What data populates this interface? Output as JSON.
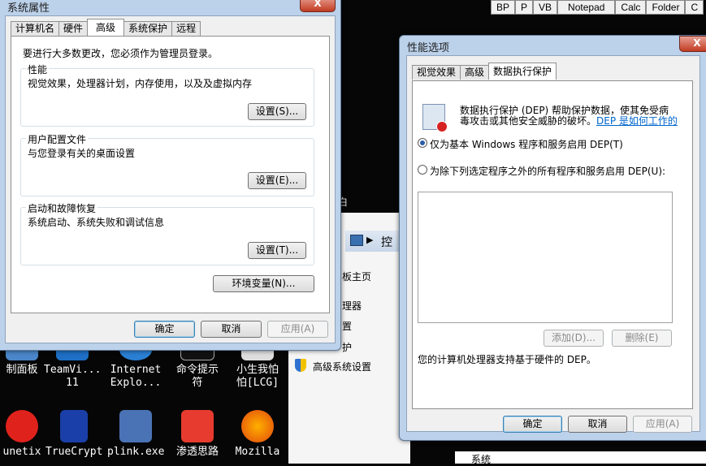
{
  "taskbar": {
    "buttons": [
      "BP",
      "P",
      "VB",
      "Notepad",
      "Calc",
      "Folder",
      "C"
    ]
  },
  "desktop": {
    "icons": [
      {
        "label1": "制面板",
        "label2": ""
      },
      {
        "label1": "TeamVi...",
        "label2": "11"
      },
      {
        "label1": "Internet",
        "label2": "Explo..."
      },
      {
        "label1": "命令提示",
        "label2": "符"
      },
      {
        "label1": "小生我怕",
        "label2": "怕[LCG]"
      },
      {
        "label1": "unetix",
        "label2": ""
      },
      {
        "label1": "TrueCrypt",
        "label2": ""
      },
      {
        "label1": "plink.exe",
        "label2": ""
      },
      {
        "label1": "渗透思路",
        "label2": ""
      },
      {
        "label1": "Mozilla",
        "label2": ""
      }
    ]
  },
  "bg_window": {
    "address": "控",
    "items": [
      "板主页",
      "理器",
      "置",
      "护",
      "高级系统设置"
    ],
    "fragment": "白",
    "bottom_label": "系统"
  },
  "sys_props": {
    "title": "系统属性",
    "close": "X",
    "tabs": [
      "计算机名",
      "硬件",
      "高级",
      "系统保护",
      "远程"
    ],
    "active_tab": "高级",
    "admin_note": "要进行大多数更改，您必须作为管理员登录。",
    "perf_label": "性能",
    "perf_desc": "视觉效果，处理器计划，内存使用，以及及虚拟内存",
    "perf_button": "设置(S)...",
    "profile_label": "用户配置文件",
    "profile_desc": "与您登录有关的桌面设置",
    "profile_button": "设置(E)...",
    "startup_label": "启动和故障恢复",
    "startup_desc": "系统启动、系统失败和调试信息",
    "startup_button": "设置(T)...",
    "env_button": "环境变量(N)...",
    "ok": "确定",
    "cancel": "取消",
    "apply": "应用(A)"
  },
  "perf_options": {
    "title": "性能选项",
    "close": "X",
    "tabs": [
      "视觉效果",
      "高级",
      "数据执行保护"
    ],
    "active_tab": "数据执行保护",
    "dep_desc_line1": "数据执行保护 (DEP) 帮助保护数据，使其免受病",
    "dep_desc_line2": "毒攻击或其他安全威胁的破坏。",
    "dep_link": "DEP 是如何工作的",
    "radio1": "仅为基本 Windows 程序和服务启用 DEP(T)",
    "radio2": "为除下列选定程序之外的所有程序和服务启用 DEP(U):",
    "add_button": "添加(D)...",
    "remove_button": "删除(E)",
    "hw_note": "您的计算机处理器支持基于硬件的 DEP。",
    "ok": "确定",
    "cancel": "取消",
    "apply": "应用(A)"
  }
}
